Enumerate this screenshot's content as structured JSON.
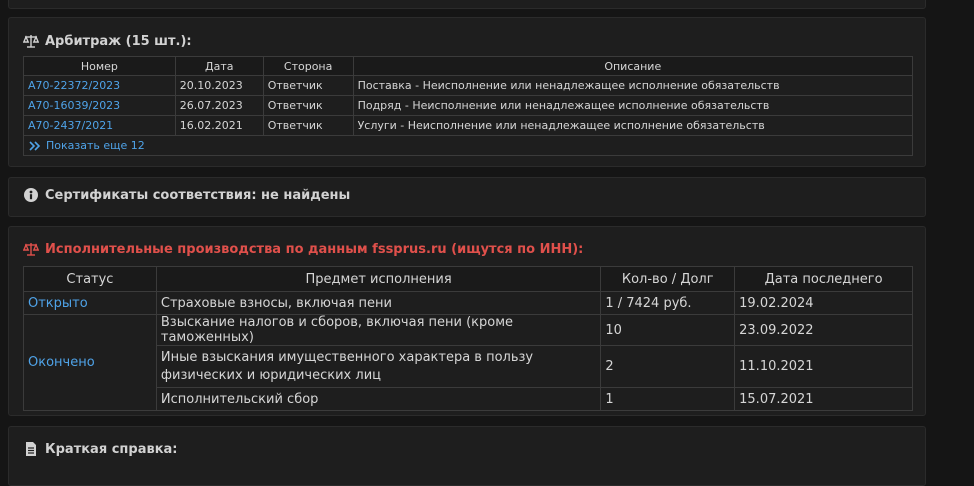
{
  "arbitration": {
    "title": "Арбитраж (15 шт.):",
    "columns": [
      "Номер",
      "Дата",
      "Сторона",
      "Описание"
    ],
    "rows": [
      {
        "number": "А70-22372/2023",
        "date": "20.10.2023",
        "side": "Ответчик",
        "description": "Поставка - Неисполнение или ненадлежащее исполнение обязательств"
      },
      {
        "number": "А70-16039/2023",
        "date": "26.07.2023",
        "side": "Ответчик",
        "description": "Подряд - Неисполнение или ненадлежащее исполнение обязательств"
      },
      {
        "number": "А70-2437/2021",
        "date": "16.02.2021",
        "side": "Ответчик",
        "description": "Услуги - Неисполнение или ненадлежащее исполнение обязательств"
      }
    ],
    "show_more": "Показать еще 12"
  },
  "certificates": {
    "title": "Сертификаты соответствия: не найдены"
  },
  "enforcement": {
    "title": "Исполнительные производства по данным fssprus.ru (ищутся по ИНН):",
    "columns": [
      "Статус",
      "Предмет исполнения",
      "Кол-во / Долг",
      "Дата последнего"
    ],
    "status_open": "Открыто",
    "status_closed": "Окончено",
    "rows": [
      {
        "subject": "Страховые взносы, включая пени",
        "amount": "1 / 7424 руб.",
        "date": "19.02.2024"
      },
      {
        "subject": "Взыскание налогов и сборов, включая пени (кроме таможенных)",
        "amount": "10",
        "date": "23.09.2022"
      },
      {
        "subject_line1": "Иные взыскания имущественного характера в пользу",
        "subject_line2": "физических и юридических лиц",
        "amount": "2",
        "date": "11.10.2021"
      },
      {
        "subject": "Исполнительский сбор",
        "amount": "1",
        "date": "15.07.2021"
      }
    ]
  },
  "summary": {
    "title": "Краткая справка:"
  },
  "colors": {
    "accent_link": "#4fa3e8",
    "danger": "#e0504b",
    "background": "#151515",
    "panel": "#1e1e1e"
  }
}
